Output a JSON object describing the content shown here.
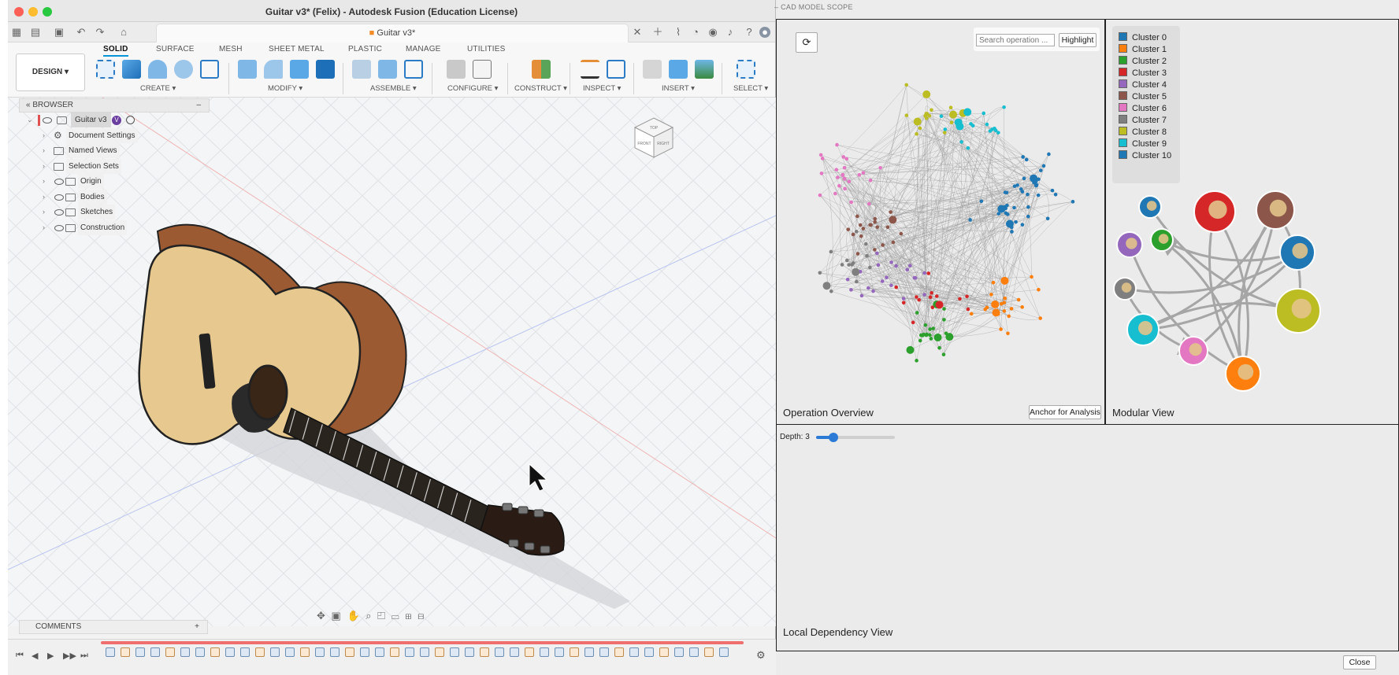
{
  "fusion": {
    "window_title": "Guitar v3* (Felix) - Autodesk Fusion (Education License)",
    "doc_tab": "Guitar v3*",
    "design_button": "DESIGN",
    "workspace_tabs": [
      "SOLID",
      "SURFACE",
      "MESH",
      "SHEET METAL",
      "PLASTIC",
      "MANAGE",
      "UTILITIES"
    ],
    "active_tab": "SOLID",
    "groups": [
      "CREATE",
      "MODIFY",
      "ASSEMBLE",
      "CONFIGURE",
      "CONSTRUCT",
      "INSPECT",
      "INSERT",
      "SELECT"
    ],
    "browser": {
      "header": "BROWSER",
      "root": "Guitar v3",
      "items": [
        "Document Settings",
        "Named Views",
        "Selection Sets",
        "Origin",
        "Bodies",
        "Sketches",
        "Construction"
      ]
    },
    "comments": "COMMENTS",
    "viewcube": {
      "top": "TOP",
      "front": "FRONT",
      "right": "RIGHT"
    },
    "timeline_icon_count": 42
  },
  "scope": {
    "title": "CAD MODEL SCOPE",
    "search_placeholder": "Search operation ...",
    "highlight_button": "Highlight",
    "operation_overview_label": "Operation Overview",
    "anchor_button": "Anchor for Analysis",
    "modular_view_label": "Modular View",
    "depth_label": "Depth: 3",
    "depth_value": 3,
    "local_dependency_label": "Local Dependency View",
    "close_button": "Close",
    "clusters": [
      {
        "name": "Cluster 0",
        "color": "#1f77b4"
      },
      {
        "name": "Cluster 1",
        "color": "#ff7f0e"
      },
      {
        "name": "Cluster 2",
        "color": "#2ca02c"
      },
      {
        "name": "Cluster 3",
        "color": "#d62728"
      },
      {
        "name": "Cluster 4",
        "color": "#9467bd"
      },
      {
        "name": "Cluster 5",
        "color": "#8c564b"
      },
      {
        "name": "Cluster 6",
        "color": "#e377c2"
      },
      {
        "name": "Cluster 7",
        "color": "#7f7f7f"
      },
      {
        "name": "Cluster 8",
        "color": "#bcbd22"
      },
      {
        "name": "Cluster 9",
        "color": "#17becf"
      },
      {
        "name": "Cluster 10",
        "color": "#1f77b4"
      }
    ]
  },
  "colors": {
    "accent": "#0696d7",
    "timeline": "#ef6f6f",
    "wood": "#9c5a33",
    "top": "#e7c98f"
  }
}
